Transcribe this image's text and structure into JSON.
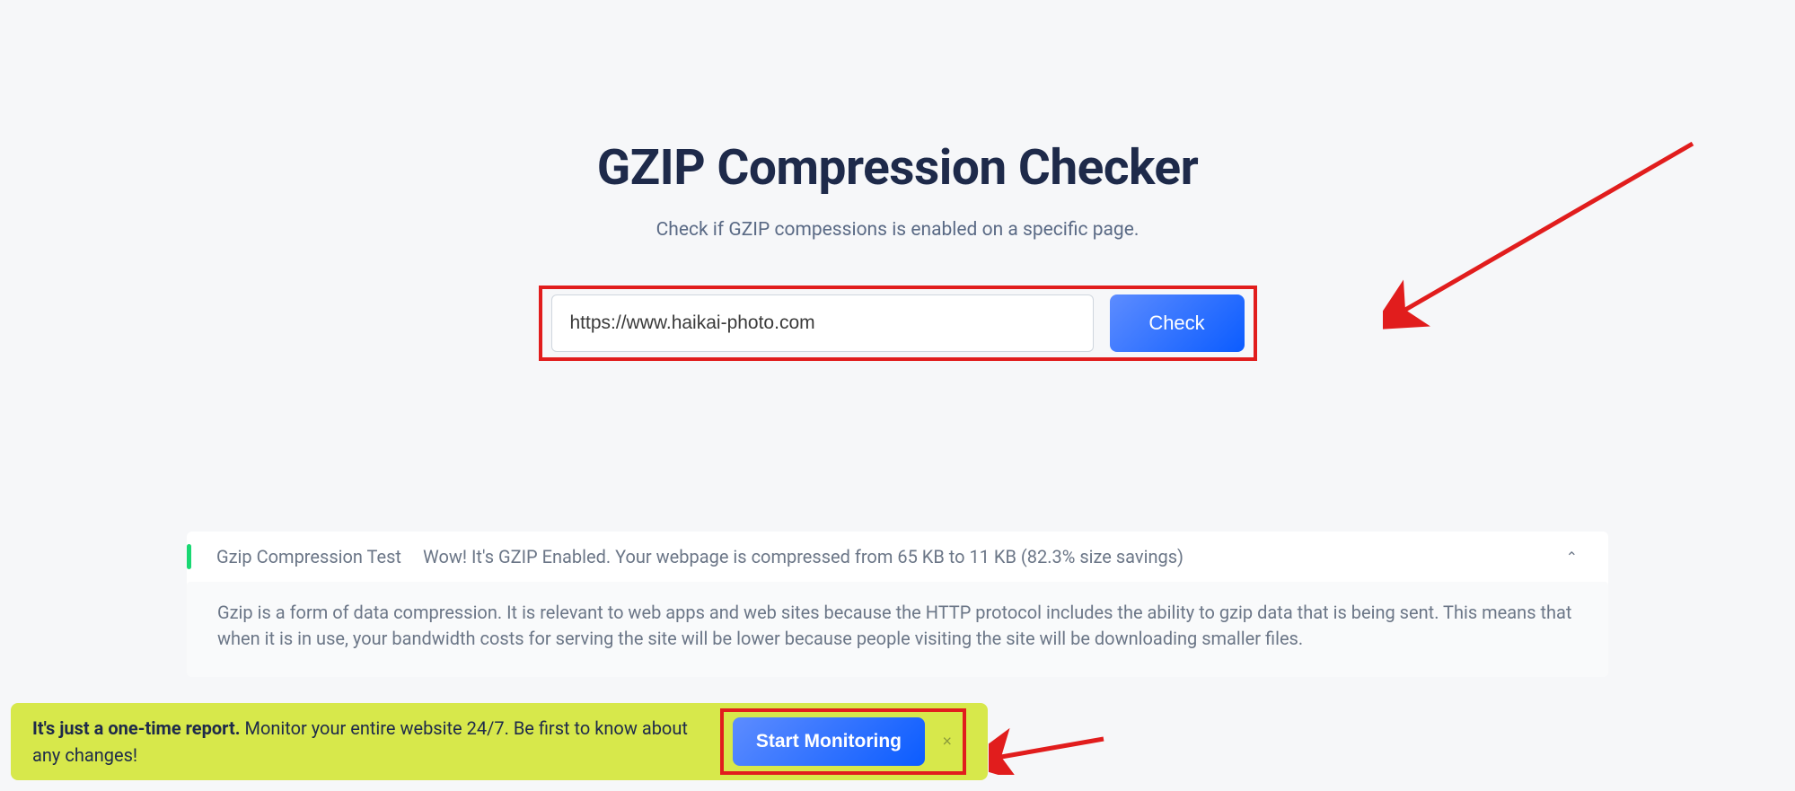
{
  "hero": {
    "title": "GZIP Compression Checker",
    "subtitle": "Check if GZIP compessions is enabled on a specific page."
  },
  "form": {
    "url_value": "https://www.haikai-photo.com",
    "check_label": "Check"
  },
  "result": {
    "title": "Gzip Compression Test",
    "message": "Wow! It's GZIP Enabled. Your webpage is compressed from 65 KB to 11 KB (82.3% size savings)",
    "description": "Gzip is a form of data compression. It is relevant to web apps and web sites because the HTTP protocol includes the ability to gzip data that is being sent. This means that when it is in use, your bandwidth costs for serving the site will be lower because people visiting the site will be downloading smaller files."
  },
  "banner": {
    "bold": "It's just a one-time report.",
    "rest": " Monitor your entire website 24/7. Be first to know about any changes!",
    "button": "Start Monitoring"
  }
}
